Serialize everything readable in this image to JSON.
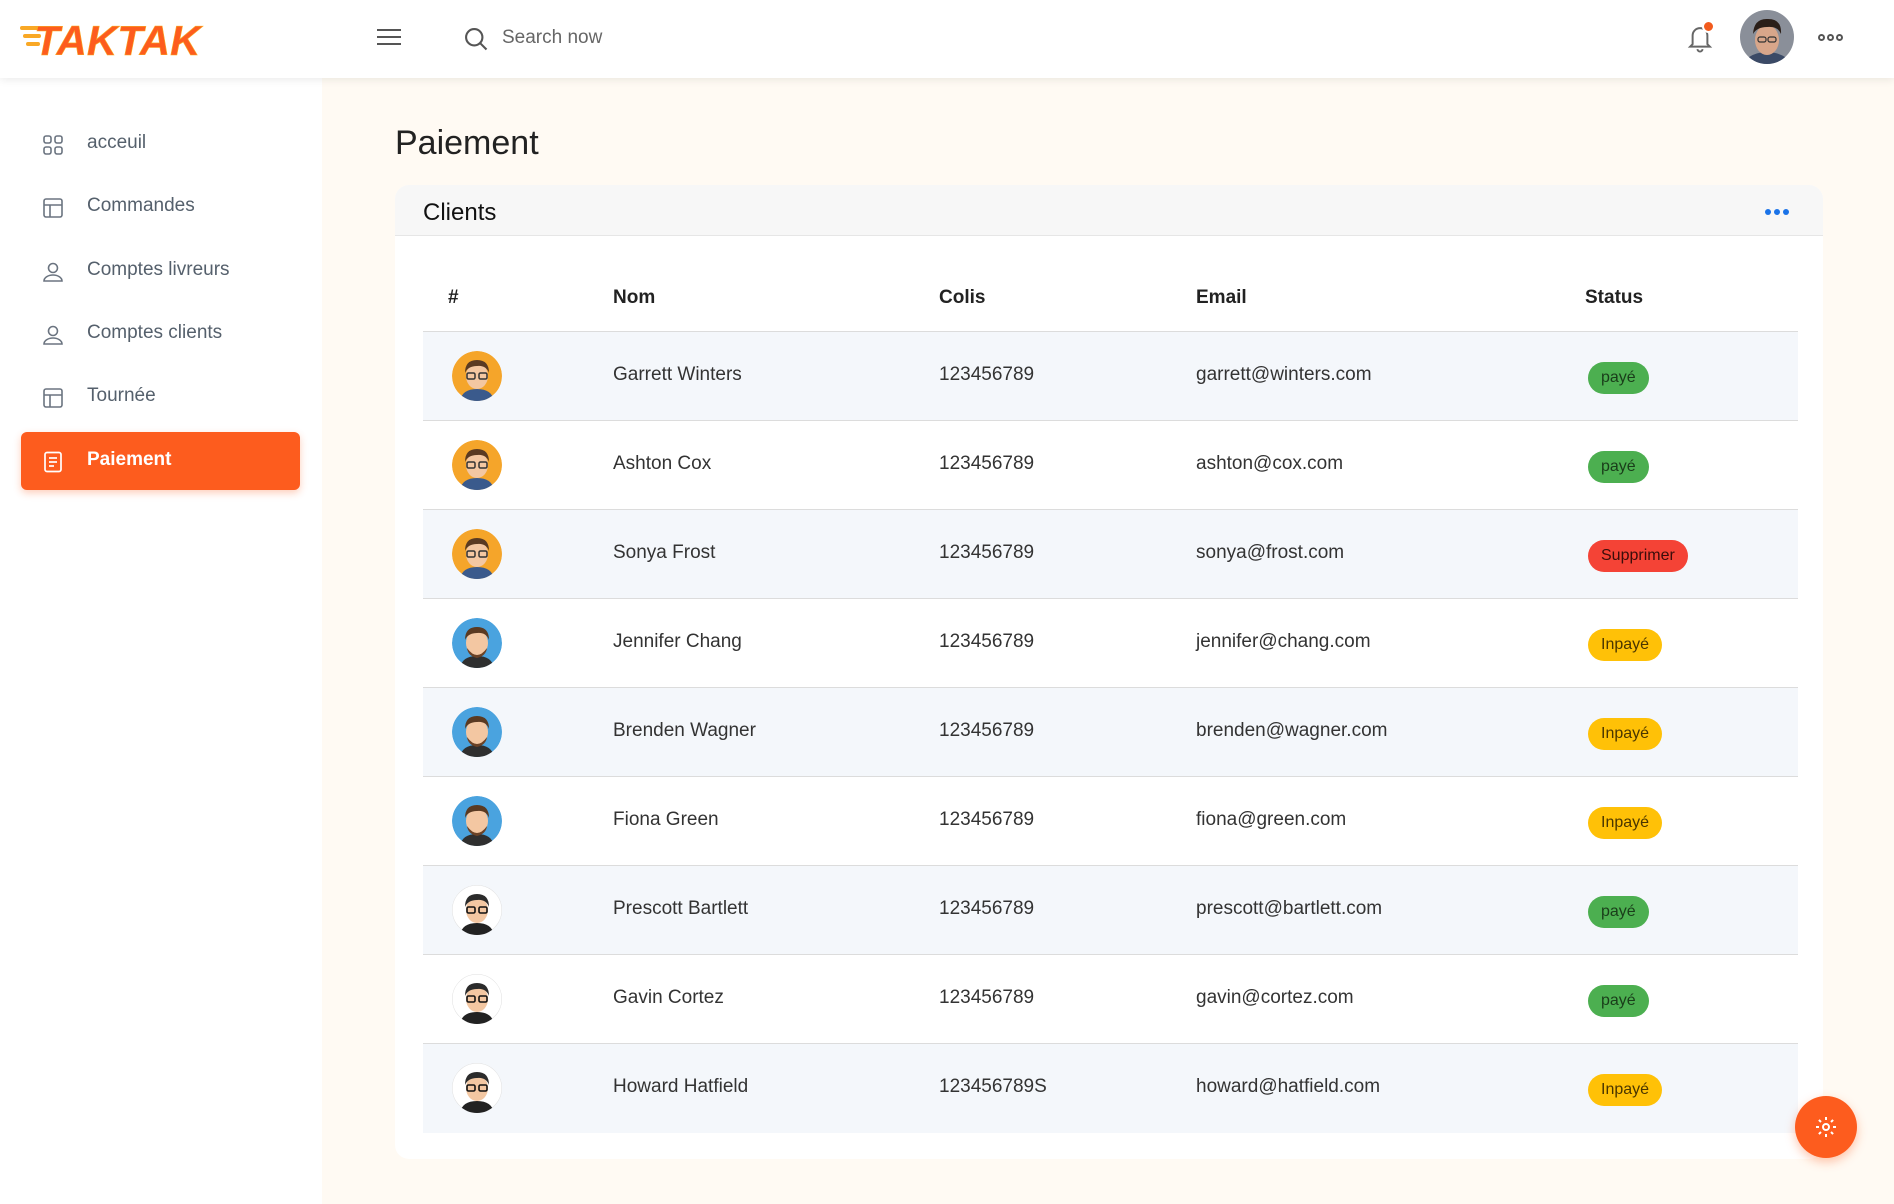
{
  "brand": {
    "name": "TAKTAK",
    "primary_color": "#fd5c1e"
  },
  "header": {
    "search_placeholder": "Search now",
    "icons": {
      "menu": "hamburger-icon",
      "search": "search-icon",
      "notifications": "bell-icon",
      "more": "more-horizontal-icon"
    }
  },
  "sidebar": {
    "items": [
      {
        "label": "acceuil",
        "icon": "grid-icon",
        "active": false
      },
      {
        "label": "Commandes",
        "icon": "layout-icon",
        "active": false
      },
      {
        "label": "Comptes livreurs",
        "icon": "user-icon",
        "active": false
      },
      {
        "label": "Comptes clients",
        "icon": "user-icon",
        "active": false
      },
      {
        "label": "Tournée",
        "icon": "layout-icon",
        "active": false
      },
      {
        "label": "Paiement",
        "icon": "document-icon",
        "active": true
      }
    ]
  },
  "page": {
    "title": "Paiement"
  },
  "card": {
    "title": "Clients"
  },
  "table": {
    "columns": [
      "#",
      "Nom",
      "Colis",
      "Email",
      "Status"
    ],
    "rows": [
      {
        "name": "Garrett Winters",
        "colis": "123456789",
        "email": "garrett@winters.com",
        "status": "payé",
        "status_type": "paid",
        "avatar": "orange-glasses"
      },
      {
        "name": "Ashton Cox",
        "colis": "123456789",
        "email": "ashton@cox.com",
        "status": "payé",
        "status_type": "paid",
        "avatar": "orange-glasses"
      },
      {
        "name": "Sonya Frost",
        "colis": "123456789",
        "email": "sonya@frost.com",
        "status": "Supprimer",
        "status_type": "del",
        "avatar": "orange-glasses"
      },
      {
        "name": "Jennifer Chang",
        "colis": "123456789",
        "email": "jennifer@chang.com",
        "status": "Inpayé",
        "status_type": "unpaid",
        "avatar": "blue-beard"
      },
      {
        "name": "Brenden Wagner",
        "colis": "123456789",
        "email": "brenden@wagner.com",
        "status": "Inpayé",
        "status_type": "unpaid",
        "avatar": "blue-beard"
      },
      {
        "name": "Fiona Green",
        "colis": "123456789",
        "email": "fiona@green.com",
        "status": "Inpayé",
        "status_type": "unpaid",
        "avatar": "blue-beard"
      },
      {
        "name": "Prescott Bartlett",
        "colis": "123456789",
        "email": "prescott@bartlett.com",
        "status": "payé",
        "status_type": "paid",
        "avatar": "white-dark"
      },
      {
        "name": "Gavin Cortez",
        "colis": "123456789",
        "email": "gavin@cortez.com",
        "status": "payé",
        "status_type": "paid",
        "avatar": "white-dark"
      },
      {
        "name": "Howard Hatfield",
        "colis": "123456789S",
        "email": "howard@hatfield.com",
        "status": "Inpayé",
        "status_type": "unpaid",
        "avatar": "white-dark"
      }
    ]
  },
  "status_colors": {
    "paid": "#4caf50",
    "del": "#f44336",
    "unpaid": "#ffc107"
  }
}
